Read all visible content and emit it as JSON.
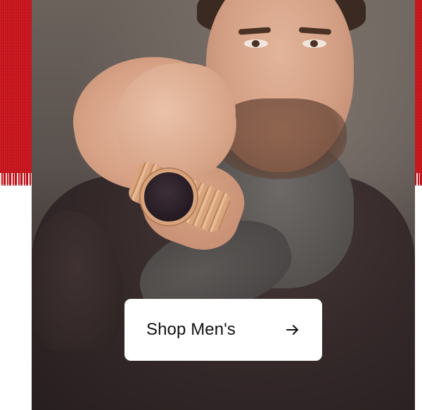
{
  "promo": {
    "cta_label": "Shop Men's",
    "cta_icon": "arrow-right-icon",
    "photo_subject": "",
    "colors": {
      "backdrop_red": "#c8141c",
      "button_bg": "#ffffff",
      "button_text": "#111111"
    }
  }
}
